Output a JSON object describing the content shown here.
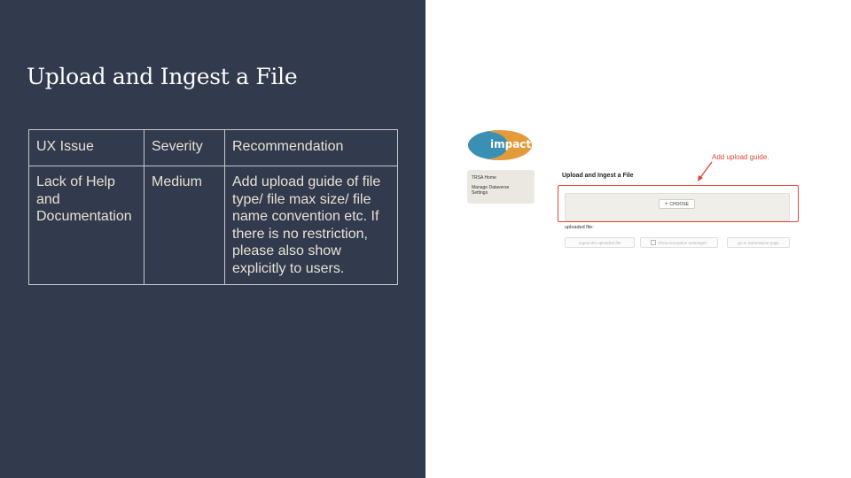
{
  "slide": {
    "title": "Upload and Ingest a File"
  },
  "table": {
    "headers": [
      "UX Issue",
      "Severity",
      "Recommendation"
    ],
    "rows": [
      {
        "issue": "Lack of Help and Documentation",
        "severity": "Medium",
        "recommendation": "Add upload guide of file type/ file max size/ file name convention etc. If there is no restriction, please also show explicitly to users."
      }
    ]
  },
  "screenshot": {
    "logo_text": "impact",
    "logo_colors": {
      "blue": "#3a8fb5",
      "orange": "#e39b3a"
    },
    "nav": {
      "items": [
        "TRSA Home",
        "Manage Dataverse",
        "Settings"
      ]
    },
    "form_title": "Upload and Ingest a File",
    "annotation": "Add upload guide.",
    "choose_button": "CHOOSE",
    "uploaded_label": "uploaded file:",
    "buttons": {
      "ingest": "Ingest the uploaded file",
      "show_exceptions": "Show Exception messages",
      "submission": "go to Submission page"
    }
  },
  "colors": {
    "panel_bg": "#323a4d",
    "highlight": "#e0453a"
  }
}
